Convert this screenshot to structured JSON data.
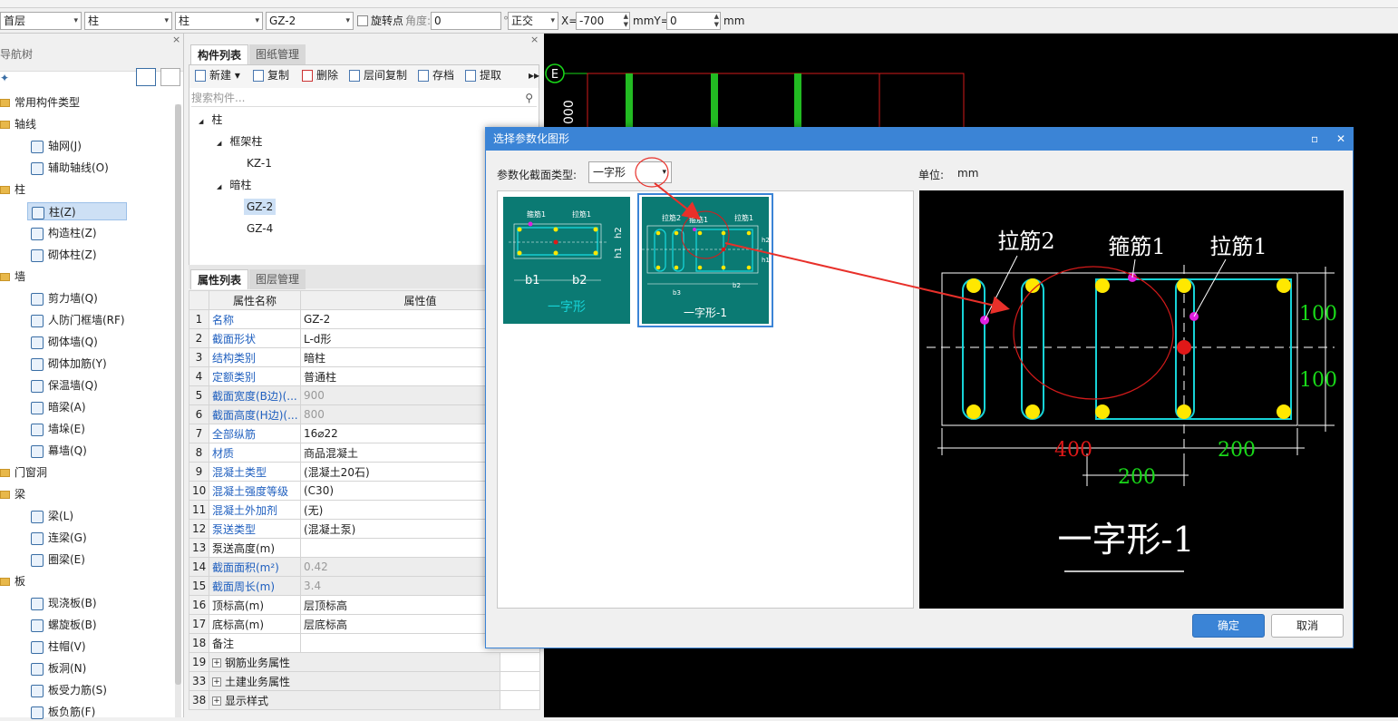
{
  "toolbar": {
    "floor": "首层",
    "category": "柱",
    "type": "柱",
    "component": "GZ-2",
    "rotate_label": "旋转点",
    "angle_label": "角度:",
    "angle_value": "0",
    "degree": "°",
    "mode": "正交",
    "x_label": "X=",
    "x_value": "-700",
    "mm_y_label": "mmY=",
    "y_value": "0",
    "mm_label": "mm"
  },
  "nav": {
    "title": "导航树",
    "items": [
      {
        "label": "常用构件类型",
        "kind": "folder"
      },
      {
        "label": "轴线",
        "kind": "folder"
      },
      {
        "label": "轴网(J)",
        "kind": "item"
      },
      {
        "label": "辅助轴线(O)",
        "kind": "item"
      },
      {
        "label": "柱",
        "kind": "folder"
      },
      {
        "label": "柱(Z)",
        "kind": "item"
      },
      {
        "label": "构造柱(Z)",
        "kind": "item"
      },
      {
        "label": "砌体柱(Z)",
        "kind": "item"
      },
      {
        "label": "墙",
        "kind": "folder"
      },
      {
        "label": "剪力墙(Q)",
        "kind": "item"
      },
      {
        "label": "人防门框墙(RF)",
        "kind": "item"
      },
      {
        "label": "砌体墙(Q)",
        "kind": "item"
      },
      {
        "label": "砌体加筋(Y)",
        "kind": "item"
      },
      {
        "label": "保温墙(Q)",
        "kind": "item"
      },
      {
        "label": "暗梁(A)",
        "kind": "item"
      },
      {
        "label": "墙垛(E)",
        "kind": "item"
      },
      {
        "label": "幕墙(Q)",
        "kind": "item"
      },
      {
        "label": "门窗洞",
        "kind": "folder"
      },
      {
        "label": "梁",
        "kind": "folder"
      },
      {
        "label": "梁(L)",
        "kind": "item"
      },
      {
        "label": "连梁(G)",
        "kind": "item"
      },
      {
        "label": "圈梁(E)",
        "kind": "item"
      },
      {
        "label": "板",
        "kind": "folder"
      },
      {
        "label": "现浇板(B)",
        "kind": "item"
      },
      {
        "label": "螺旋板(B)",
        "kind": "item"
      },
      {
        "label": "柱帽(V)",
        "kind": "item"
      },
      {
        "label": "板洞(N)",
        "kind": "item"
      },
      {
        "label": "板受力筋(S)",
        "kind": "item"
      },
      {
        "label": "板负筋(F)",
        "kind": "item"
      }
    ]
  },
  "components": {
    "tabs": [
      "构件列表",
      "图纸管理"
    ],
    "buttons": [
      "新建",
      "复制",
      "删除",
      "层间复制",
      "存档",
      "提取"
    ],
    "search_placeholder": "搜索构件...",
    "tree": [
      {
        "label": "柱",
        "level": 0
      },
      {
        "label": "框架柱",
        "level": 1
      },
      {
        "label": "KZ-1",
        "level": 2
      },
      {
        "label": "暗柱",
        "level": 1
      },
      {
        "label": "GZ-2",
        "level": 2
      },
      {
        "label": "GZ-4",
        "level": 2
      }
    ]
  },
  "properties": {
    "tabs": [
      "属性列表",
      "图层管理"
    ],
    "col_name": "属性名称",
    "col_value": "属性值",
    "rows": [
      {
        "n": "1",
        "k": "名称",
        "v": "GZ-2",
        "blue": true,
        "gray": false
      },
      {
        "n": "2",
        "k": "截面形状",
        "v": "L-d形",
        "blue": true,
        "gray": false
      },
      {
        "n": "3",
        "k": "结构类别",
        "v": "暗柱",
        "blue": true,
        "gray": false
      },
      {
        "n": "4",
        "k": "定额类别",
        "v": "普通柱",
        "blue": true,
        "gray": false
      },
      {
        "n": "5",
        "k": "截面宽度(B边)(...",
        "v": "900",
        "blue": true,
        "gray": true
      },
      {
        "n": "6",
        "k": "截面高度(H边)(...",
        "v": "800",
        "blue": true,
        "gray": true
      },
      {
        "n": "7",
        "k": "全部纵筋",
        "v": "16⌀22",
        "blue": true,
        "gray": false
      },
      {
        "n": "8",
        "k": "材质",
        "v": "商品混凝土",
        "blue": true,
        "gray": false
      },
      {
        "n": "9",
        "k": "混凝土类型",
        "v": "(混凝土20石)",
        "blue": true,
        "gray": false
      },
      {
        "n": "10",
        "k": "混凝土强度等级",
        "v": "(C30)",
        "blue": true,
        "gray": false
      },
      {
        "n": "11",
        "k": "混凝土外加剂",
        "v": "(无)",
        "blue": true,
        "gray": false
      },
      {
        "n": "12",
        "k": "泵送类型",
        "v": "(混凝土泵)",
        "blue": true,
        "gray": false
      },
      {
        "n": "13",
        "k": "泵送高度(m)",
        "v": "",
        "blue": false,
        "gray": false
      },
      {
        "n": "14",
        "k": "截面面积(m²)",
        "v": "0.42",
        "blue": true,
        "gray": true
      },
      {
        "n": "15",
        "k": "截面周长(m)",
        "v": "3.4",
        "blue": true,
        "gray": true
      },
      {
        "n": "16",
        "k": "顶标高(m)",
        "v": "层顶标高",
        "blue": false,
        "gray": false
      },
      {
        "n": "17",
        "k": "底标高(m)",
        "v": "层底标高",
        "blue": false,
        "gray": false
      },
      {
        "n": "18",
        "k": "备注",
        "v": "",
        "blue": false,
        "gray": false
      },
      {
        "n": "19",
        "k": "钢筋业务属性",
        "v": "",
        "blue": false,
        "gray": false,
        "group": true
      },
      {
        "n": "33",
        "k": "土建业务属性",
        "v": "",
        "blue": false,
        "gray": false,
        "group": true
      },
      {
        "n": "38",
        "k": "显示样式",
        "v": "",
        "blue": false,
        "gray": false,
        "group": true
      }
    ]
  },
  "canvas": {
    "axis_label": "E",
    "dim_text": "000"
  },
  "dialog": {
    "title": "选择参数化图形",
    "type_label": "参数化截面类型:",
    "type_value": "一字形",
    "unit_label": "单位:",
    "unit_value": "mm",
    "thumbs": [
      {
        "caption": "一字形",
        "t1": "箍筋1",
        "t2": "拉筋1",
        "d1": "b1",
        "d2": "b2",
        "h1": "h1",
        "h2": "h2"
      },
      {
        "caption": "一字形-1",
        "t1": "拉筋2",
        "t2": "箍筋1",
        "t3": "拉筋1",
        "d1": "b3",
        "d2": "b2",
        "h1": "h1",
        "h2": "h2"
      }
    ],
    "preview": {
      "label_a": "拉筋2",
      "label_b": "箍筋1",
      "label_c": "拉筋1",
      "dim_h1": "100",
      "dim_h2": "100",
      "dim_w1": "400",
      "dim_w2": "200",
      "dim_w3": "200",
      "caption": "一字形-1"
    },
    "ok": "确定",
    "cancel": "取消"
  },
  "colors": {
    "accent": "#3b84d6",
    "teal": "#0b7a73",
    "cyan": "#17d3d7",
    "green_dim": "#19d919",
    "red_dim": "#e01818"
  }
}
